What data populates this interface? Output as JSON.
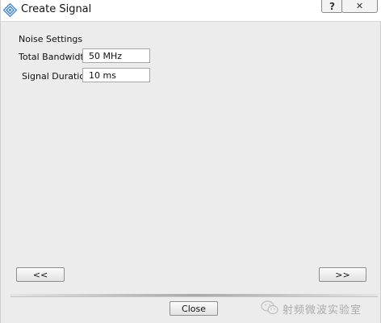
{
  "window": {
    "title": "Create Signal",
    "help_label": "?",
    "close_label": "✕"
  },
  "noise_settings": {
    "section_title": "Noise Settings",
    "total_bandwidth": {
      "label": "Total Bandwidth",
      "value": "50 MHz"
    },
    "signal_duration": {
      "label": "Signal Duration",
      "value": "10 ms"
    }
  },
  "navigation": {
    "prev_label": "<<",
    "next_label": ">>"
  },
  "footer": {
    "close_label": "Close"
  },
  "watermark": {
    "text": "射频微波实验室",
    "icon": "wechat-icon"
  },
  "colors": {
    "dialog_bg": "#ececec",
    "titlebar_bg": "#ffffff",
    "app_icon_blue": "#3d7fc1"
  }
}
